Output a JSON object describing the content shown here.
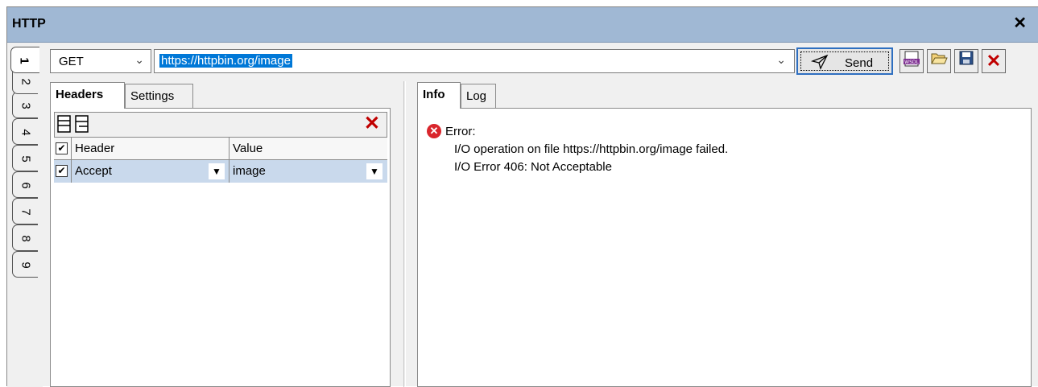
{
  "window": {
    "title": "HTTP",
    "close_glyph": "✕"
  },
  "vertical_tabs": [
    "1",
    "2",
    "3",
    "4",
    "5",
    "6",
    "7",
    "8",
    "9"
  ],
  "request": {
    "method": "GET",
    "url": "https://httpbin.org/image",
    "send_label": "Send"
  },
  "toolbar": {
    "wsdl_icon": "wsdl-icon",
    "open_icon": "open-folder-icon",
    "save_icon": "save-icon",
    "close_icon": "close-icon"
  },
  "left_tabs": [
    "Headers",
    "Settings"
  ],
  "headers_grid": {
    "columns": [
      "Header",
      "Value"
    ],
    "rows": [
      {
        "checked": true,
        "header": "Accept",
        "value": "image"
      }
    ]
  },
  "right_tabs": [
    "Info",
    "Log"
  ],
  "info": {
    "status": "Error:",
    "lines": [
      "I/O operation on file https://httpbin.org/image failed.",
      "I/O Error 406: Not Acceptable"
    ]
  },
  "colors": {
    "titlebar": "#a0b8d4",
    "selection": "#0078d7",
    "error": "#d9262c",
    "row_highlight": "#c9d9ec"
  }
}
